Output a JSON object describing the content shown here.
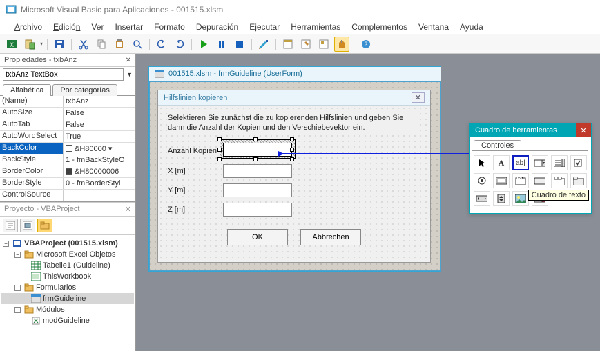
{
  "window": {
    "title": "Microsoft Visual Basic para Aplicaciones - 001515.xlsm"
  },
  "menu": {
    "file": "Archivo",
    "edit": "Edición",
    "view": "Ver",
    "insert": "Insertar",
    "format": "Formato",
    "debug": "Depuración",
    "run": "Ejecutar",
    "tools": "Herramientas",
    "addins": "Complementos",
    "window": "Ventana",
    "help": "Ayuda"
  },
  "properties": {
    "panel_title": "Propiedades - txbAnz",
    "object": "txbAnz TextBox",
    "tabs": {
      "alpha": "Alfabética",
      "cat": "Por categorías"
    },
    "rows": [
      {
        "k": "(Name)",
        "v": "txbAnz"
      },
      {
        "k": "AutoSize",
        "v": "False"
      },
      {
        "k": "AutoTab",
        "v": "False"
      },
      {
        "k": "AutoWordSelect",
        "v": "True"
      },
      {
        "k": "BackColor",
        "v": "&H80000 ▾",
        "swatch": "#ffffff",
        "sel": true
      },
      {
        "k": "BackStyle",
        "v": "1 - fmBackStyleO"
      },
      {
        "k": "BorderColor",
        "v": "&H80000006",
        "swatch": "#404040"
      },
      {
        "k": "BorderStyle",
        "v": "0 - fmBorderStyl"
      },
      {
        "k": "ControlSource",
        "v": ""
      }
    ]
  },
  "project": {
    "panel_title": "Proyecto - VBAProject",
    "root": "VBAProject (001515.xlsm)",
    "folders": {
      "objects": "Microsoft Excel Objetos",
      "forms": "Formularios",
      "modules": "Módulos"
    },
    "items": {
      "sheet": "Tabelle1 (Guideline)",
      "wb": "ThisWorkbook",
      "form": "frmGuideline",
      "module": "modGuideline"
    }
  },
  "designer": {
    "mdi_title": "001515.xlsm - frmGuideline (UserForm)",
    "dlg_title": "Hilfslinien kopieren",
    "instr": "Selektieren Sie zunächst die zu kopierenden Hilfslinien und geben Sie dann die Anzahl der Kopien und den Verschiebevektor ein.",
    "lbl_anzahl": "Anzahl Kopien",
    "lbl_x": "X [m]",
    "lbl_y": "Y [m]",
    "lbl_z": "Z [m]",
    "btn_ok": "OK",
    "btn_cancel": "Abbrechen"
  },
  "toolbox": {
    "title": "Cuadro de herramientas",
    "tab": "Controles",
    "tooltip": "Cuadro de texto"
  }
}
